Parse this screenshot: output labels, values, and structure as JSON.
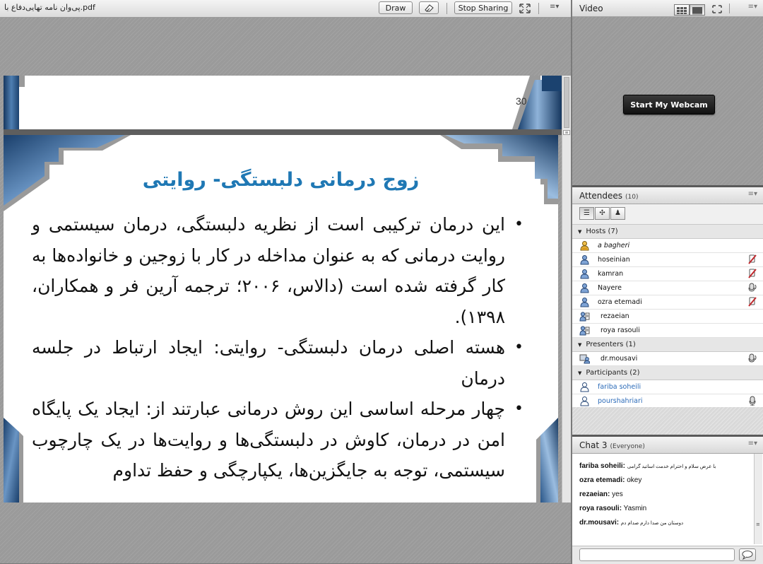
{
  "share": {
    "document_title": "پی‌وان نامه تهایی‌دفاع با.pdf",
    "draw_label": "Draw",
    "stop_sharing_label": "Stop Sharing"
  },
  "slide": {
    "page_number": "30",
    "title": "زوج درمانی دلبستگی- روایتی",
    "bullets": [
      "این درمان ترکیبی است از نظریه دلبستگی، درمان سیستمی و روایت درمانی که به عنوان مداخله در کار با زوجین و خانواده‌ها به کار گرفته شده است (دالاس، ۲۰۰۶؛ ترجمه آرین فر و همکاران، ۱۳۹۸).",
      "هسته اصلی درمان دلبستگی- روایتی: ایجاد ارتباط در جلسه درمان",
      "چهار مرحله اساسی این روش درمانی عبارتند از: ایجاد یک پایگاه امن در درمان، کاوش در دلبستگی‌ها و روایت‌ها در یک چارچوب سیستمی، توجه به جایگزین‌ها، یکپارچگی و حفظ تداوم"
    ]
  },
  "video": {
    "title": "Video",
    "webcam_button_label": "Start My Webcam"
  },
  "attendees": {
    "title": "Attendees",
    "count": "(10)",
    "groups": {
      "hosts": {
        "label": "Hosts (7)",
        "members": [
          "a bagheri",
          "hoseinian",
          "kamran",
          "Nayere",
          "ozra etemadi",
          "rezaeian",
          "roya rasouli"
        ]
      },
      "presenters": {
        "label": "Presenters (1)",
        "members": [
          "dr.mousavi"
        ]
      },
      "participants": {
        "label": "Participants (2)",
        "members": [
          "fariba soheili",
          "pourshahriari"
        ]
      }
    }
  },
  "chat": {
    "title": "Chat 3",
    "scope": "(Everyone)",
    "messages": [
      {
        "sender": "fariba soheili:",
        "text": "با عرض سلام و احترام خدمت اساتید گرامی"
      },
      {
        "sender": "ozra etemadi:",
        "text": "okey"
      },
      {
        "sender": "rezaeian:",
        "text": "yes"
      },
      {
        "sender": "roya rasouli:",
        "text": "Yasmin"
      },
      {
        "sender": "dr.mousavi:",
        "text": "دوستان من صدا دارم صدام دم"
      }
    ]
  },
  "colors": {
    "slide_title": "#1f78b4",
    "slide_frame_blue": "#1e4a7e",
    "participant_name": "#2a6ab8",
    "mic_off_red": "#c0282d"
  }
}
